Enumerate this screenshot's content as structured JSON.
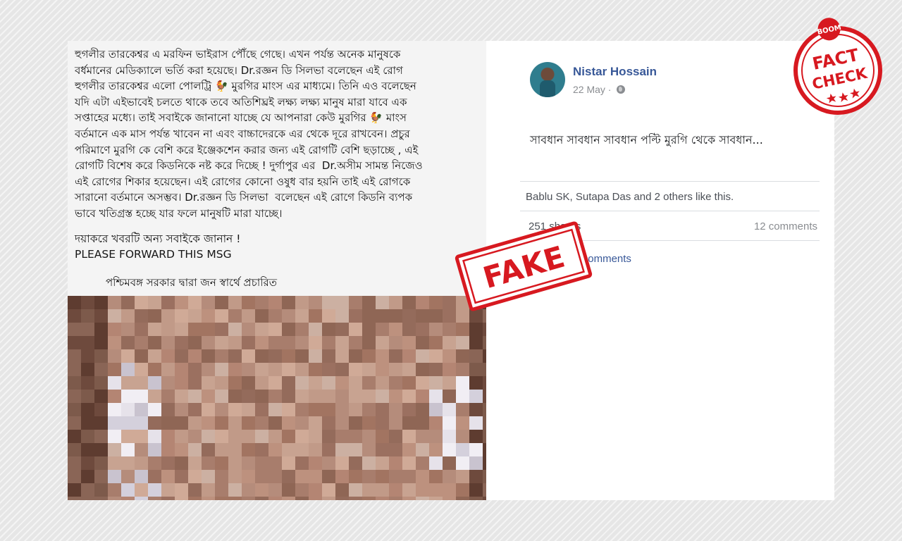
{
  "left_post": {
    "message": "হুগলীর তারকেশ্বর এ মরফিন ভাইরাস পৌঁছে গেছে। এখন পর্যন্ত অনেক মানুষকে\nবর্ধমানের মেডিক্যালে ভর্তি করা হয়েছে। Dr.রজ্ঞন ডি সিলভা বলেছেন এই রোগ\nহুগলীর তারকেশ্বর এলো পোলট্রি 🐓 মুরগির মাংস এর মাধ্যমে। তিনি এও বলেছেন\nযদি এটা এইভাবেই চলতে থাকে তবে অতিশিঘ্রই লক্ষ্য লক্ষ্য মানুষ মারা যাবে এক\nসপ্তাহের মধ্যে। তাই সবাইকে জানানো যাচ্ছে যে আপনারা কেউ মুরগির 🐓 মাংস\nবর্তমানে এক মাস পর্যন্ত খাবেন না এবং বাচ্চাদেরকে এর থেকে দূরে রাখবেন। প্রচুর\nপরিমাণে মুরগি কে বেশি করে ইঞ্জেকশেন করার জন্য এই রোগটি বেশি ছড়াচ্ছে , এই\nরোগটি বিশেষ করে কিডনিকে নষ্ট করে দিচ্ছে ! দুর্গাপুর এর  Dr.অসীম সামন্ত নিজেও\nএই রোগের শিকার হয়েছেন। এই রোগের কোনো ওষুধ বার হয়নি তাই এই রোগকে\nসারানো বর্তমানে অসম্ভব। Dr.রজ্ঞন ডি সিলভা  বলেছেন এই রোগে কিডনি ব্যপক\nভাবে খতিগ্রস্ত হচ্ছে যার ফলে মানুষটি মারা যাচ্ছে।",
    "request_line": "দয়াকরে খবরটি অন্য সবাইকে জানান !",
    "forward_line": "PLEASE FORWARD THIS MSG",
    "govt_line": "পশ্চিমবঙ্গ সরকার    দ্বারা জন স্বার্থে প্রচারিত"
  },
  "right_post": {
    "author": "Nistar Hossain",
    "date": "22 May ·",
    "status_text": "সাবধান সাবধান সাবধান পল্টি মুরগি থেকে সাবধান...",
    "likes_text": "Bablu SK, Sutapa Das and 2 others like this.",
    "shares_text": "251 shares",
    "comments_text": "12 comments",
    "more_comments_text": "View more comments"
  },
  "stamp": {
    "label": "FAKE",
    "color": "#d71920"
  },
  "badge": {
    "top": "BOOM",
    "line1": "FACT",
    "line2": "CHECK",
    "color": "#d71920"
  },
  "icons": [
    "globe-icon",
    "rooster-emoji-icon"
  ],
  "colors": {
    "link": "#385898",
    "muted": "#8a8d91",
    "stamp_red": "#d71920"
  }
}
